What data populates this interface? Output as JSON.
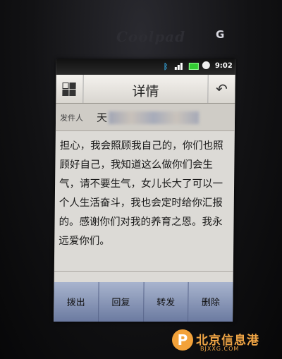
{
  "phone": {
    "brand": "Coolpad",
    "brand_mark": "G"
  },
  "statusbar": {
    "time": "9:02"
  },
  "header": {
    "title": "详情"
  },
  "sender": {
    "label": "发件人",
    "value": "天"
  },
  "message": {
    "body": "担心，我会照顾我自己的，你们也照顾好自己，我知道这么做你们会生气，请不要生气，女儿长大了可以一个人生活奋斗，我也会定时给你汇报的。感谢你们对我的养育之恩。我永远爱你们。"
  },
  "actions": {
    "dial": "拨出",
    "reply": "回复",
    "forward": "转发",
    "delete": "删除"
  },
  "watermark": {
    "name": "北京信息港",
    "url": "BJXXG.COM"
  },
  "colors": {
    "screen": "#dcdad6",
    "action_bar": "#7f8cb0",
    "watermark": "#f0a545"
  }
}
